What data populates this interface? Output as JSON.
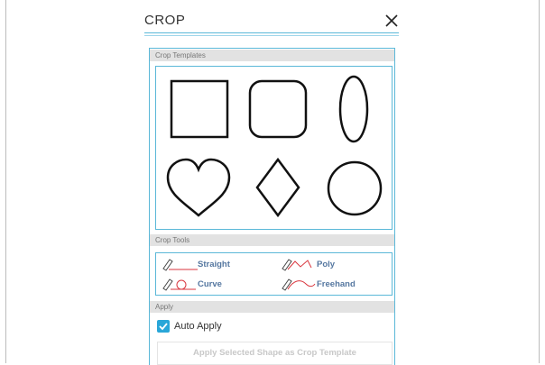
{
  "dialog": {
    "title": "CROP"
  },
  "sections": {
    "templates": "Crop Templates",
    "tools": "Crop Tools",
    "apply": "Apply"
  },
  "templates": [
    {
      "name": "square"
    },
    {
      "name": "rounded-square"
    },
    {
      "name": "ellipse"
    },
    {
      "name": "heart"
    },
    {
      "name": "diamond"
    },
    {
      "name": "circle"
    }
  ],
  "tools": {
    "straight": "Straight",
    "poly": "Poly",
    "curve": "Curve",
    "freehand": "Freehand"
  },
  "apply": {
    "auto_apply_label": "Auto Apply",
    "auto_apply_checked": true,
    "apply_button": "Apply Selected Shape as Crop Template"
  },
  "colors": {
    "accent": "#29a6d8",
    "border": "#5bb8d8",
    "tool_label": "#5577a0",
    "tool_stroke": "#d9363e"
  }
}
